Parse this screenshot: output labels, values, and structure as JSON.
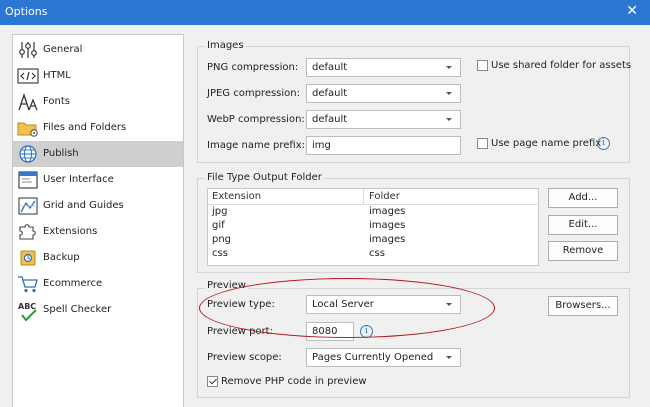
{
  "window": {
    "title": "Options",
    "close_glyph": "✕"
  },
  "sidebar": {
    "items": [
      {
        "label": "General",
        "icon": "sliders-icon"
      },
      {
        "label": "HTML",
        "icon": "code-icon"
      },
      {
        "label": "Fonts",
        "icon": "fonts-icon"
      },
      {
        "label": "Files and Folders",
        "icon": "folder-gear-icon"
      },
      {
        "label": "Publish",
        "icon": "globe-icon",
        "selected": true
      },
      {
        "label": "User Interface",
        "icon": "window-icon"
      },
      {
        "label": "Grid and Guides",
        "icon": "grid-guides-icon"
      },
      {
        "label": "Extensions",
        "icon": "puzzle-icon"
      },
      {
        "label": "Backup",
        "icon": "backup-icon"
      },
      {
        "label": "Ecommerce",
        "icon": "cart-icon"
      },
      {
        "label": "Spell Checker",
        "icon": "spell-check-icon"
      }
    ]
  },
  "images": {
    "legend": "Images",
    "png_label": "PNG compression:",
    "png_value": "default",
    "jpeg_label": "JPEG compression:",
    "jpeg_value": "default",
    "webp_label": "WebP compression:",
    "webp_value": "default",
    "prefix_label": "Image name prefix:",
    "prefix_value": "img",
    "shared_folder_label": "Use shared folder for assets",
    "page_name_prefix_label": "Use page name prefix",
    "info_glyph": "i"
  },
  "file_types": {
    "legend": "File Type Output Folder",
    "col_extension": "Extension",
    "col_folder": "Folder",
    "rows": [
      {
        "extension": "jpg",
        "folder": "images"
      },
      {
        "extension": "gif",
        "folder": "images"
      },
      {
        "extension": "png",
        "folder": "images"
      },
      {
        "extension": "css",
        "folder": "css"
      }
    ],
    "add_label": "Add...",
    "edit_label": "Edit...",
    "remove_label": "Remove"
  },
  "preview": {
    "legend": "Preview",
    "type_label": "Preview type:",
    "type_value": "Local Server",
    "browsers_label": "Browsers...",
    "port_label": "Preview port:",
    "port_value": "8080",
    "scope_label": "Preview scope:",
    "scope_value": "Pages Currently Opened",
    "remove_php_label": "Remove PHP code in preview",
    "info_glyph": "i"
  },
  "colors": {
    "titlebar": "#2b78d4",
    "selected_item": "#cfcfcf",
    "annotation": "#b5161c",
    "info": "#3a78c8"
  }
}
